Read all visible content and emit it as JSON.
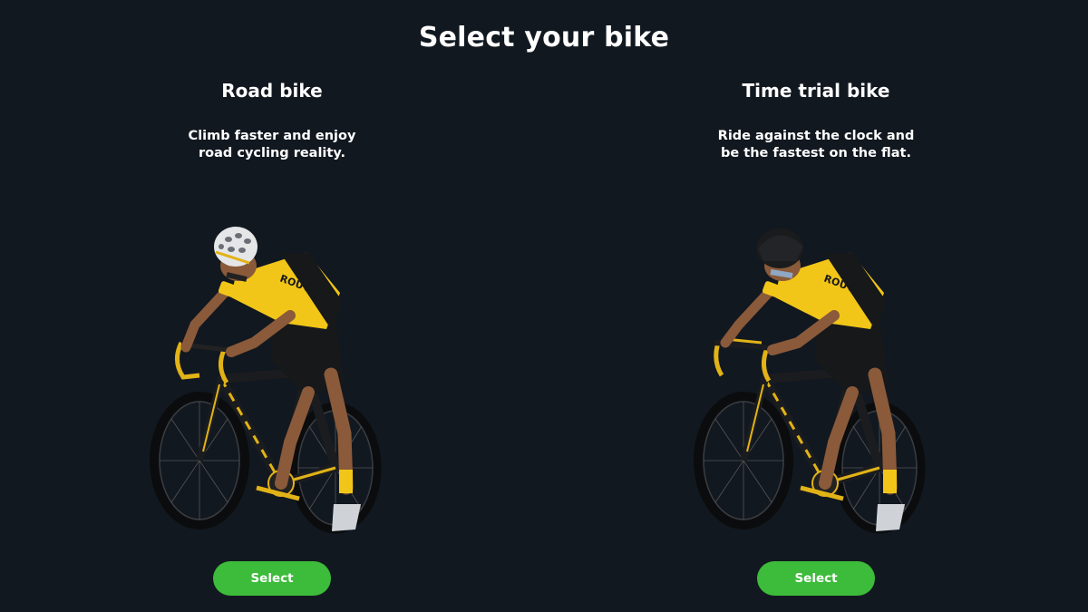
{
  "page": {
    "title": "Select your bike"
  },
  "options": [
    {
      "title": "Road bike",
      "description_line1": "Climb faster and enjoy",
      "description_line2": "road cycling reality.",
      "button_label": "Select",
      "jersey_text": "ROUVY",
      "helmet": "white-vented",
      "handlebar": "drop-bar"
    },
    {
      "title": "Time trial bike",
      "description_line1": "Ride against the clock and",
      "description_line2": "be the fastest on the flat.",
      "button_label": "Select",
      "jersey_text": "ROUVY",
      "helmet": "black-aero",
      "handlebar": "aero-bar"
    }
  ],
  "colors": {
    "background": "#121820",
    "accent_green": "#3dbb3a",
    "jersey_yellow": "#f2c618",
    "jersey_black": "#17181a",
    "skin": "#8a5a3a"
  }
}
